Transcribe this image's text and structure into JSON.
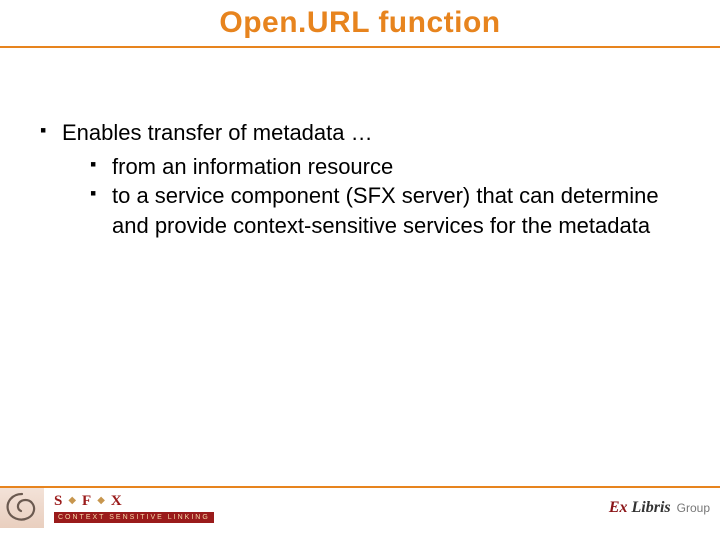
{
  "title": "Open.URL function",
  "bullets": {
    "main": "Enables transfer of metadata …",
    "sub1": "from an information resource",
    "sub2": "to a service component (SFX server) that can determine and provide context-sensitive services for the metadata"
  },
  "footer": {
    "sfx": {
      "s": "S",
      "f": "F",
      "x": "X"
    },
    "tagline": "CONTEXT SENSITIVE LINKING",
    "brand": {
      "ex": "Ex",
      "libris": "Libris",
      "group": "Group"
    }
  }
}
